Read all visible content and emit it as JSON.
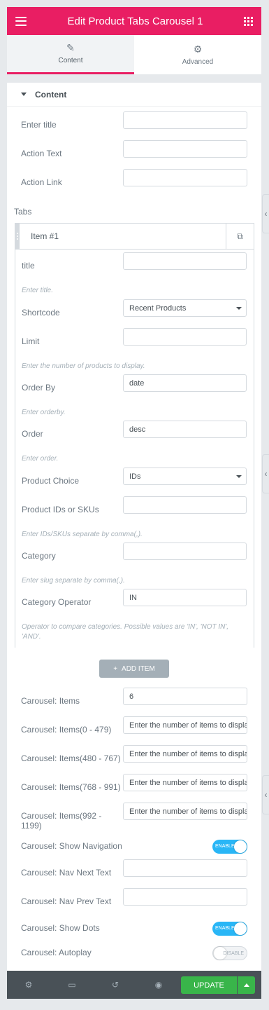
{
  "header": {
    "title": "Edit Product Tabs Carousel 1",
    "menu_icon": "hamburger-icon",
    "apps_icon": "grid-icon"
  },
  "tabs": [
    {
      "label": "Content",
      "icon": "pencil-icon",
      "active": true
    },
    {
      "label": "Advanced",
      "icon": "gear-icon",
      "active": false
    }
  ],
  "section": {
    "title": "Content"
  },
  "fields": {
    "enter_title": {
      "label": "Enter title",
      "value": ""
    },
    "action_text": {
      "label": "Action Text",
      "value": ""
    },
    "action_link": {
      "label": "Action Link",
      "value": ""
    }
  },
  "tabs_label": "Tabs",
  "repeater": {
    "item_title": "Item #1",
    "title": {
      "label": "title",
      "value": "",
      "hint": "Enter title."
    },
    "shortcode": {
      "label": "Shortcode",
      "value": "Recent Products"
    },
    "limit": {
      "label": "Limit",
      "value": "",
      "hint": "Enter the number of products to display."
    },
    "order_by": {
      "label": "Order By",
      "value": "date",
      "hint": "Enter orderby."
    },
    "order": {
      "label": "Order",
      "value": "desc",
      "hint": "Enter order."
    },
    "product_choice": {
      "label": "Product Choice",
      "value": "IDs"
    },
    "product_ids": {
      "label": "Product IDs or SKUs",
      "value": "",
      "hint": "Enter IDs/SKUs separate by comma(,)."
    },
    "category": {
      "label": "Category",
      "value": "",
      "hint": "Enter slug separate by comma(,)."
    },
    "category_operator": {
      "label": "Category Operator",
      "value": "IN",
      "hint": "Operator to compare categories. Possible values are 'IN', 'NOT IN', 'AND'."
    }
  },
  "add_item_label": "ADD ITEM",
  "carousel": {
    "items": {
      "label": "Carousel: Items",
      "value": "6"
    },
    "items_0_479": {
      "label": "Carousel: Items(0 - 479)",
      "placeholder": "Enter the number of items to display"
    },
    "items_480_767": {
      "label": "Carousel: Items(480 - 767)",
      "placeholder": "Enter the number of items to display"
    },
    "items_768_991": {
      "label": "Carousel: Items(768 - 991)",
      "placeholder": "Enter the number of items to display"
    },
    "items_992_1199": {
      "label": "Carousel: Items(992 - 1199)",
      "placeholder": "Enter the number of items to display"
    },
    "show_navigation": {
      "label": "Carousel: Show Navigation",
      "state": "ENABLE",
      "on": true
    },
    "nav_next_text": {
      "label": "Carousel: Nav Next Text",
      "value": ""
    },
    "nav_prev_text": {
      "label": "Carousel: Nav Prev Text",
      "value": ""
    },
    "show_dots": {
      "label": "Carousel: Show Dots",
      "state": "ENABLE",
      "on": true
    },
    "autoplay": {
      "label": "Carousel: Autoplay",
      "state": "DISABLE",
      "on": false
    }
  },
  "footer": {
    "update_label": "UPDATE"
  },
  "colors": {
    "brand": "#e91e63",
    "update": "#39b54a",
    "toggle_on": "#29b6f6",
    "footer": "#495157"
  }
}
